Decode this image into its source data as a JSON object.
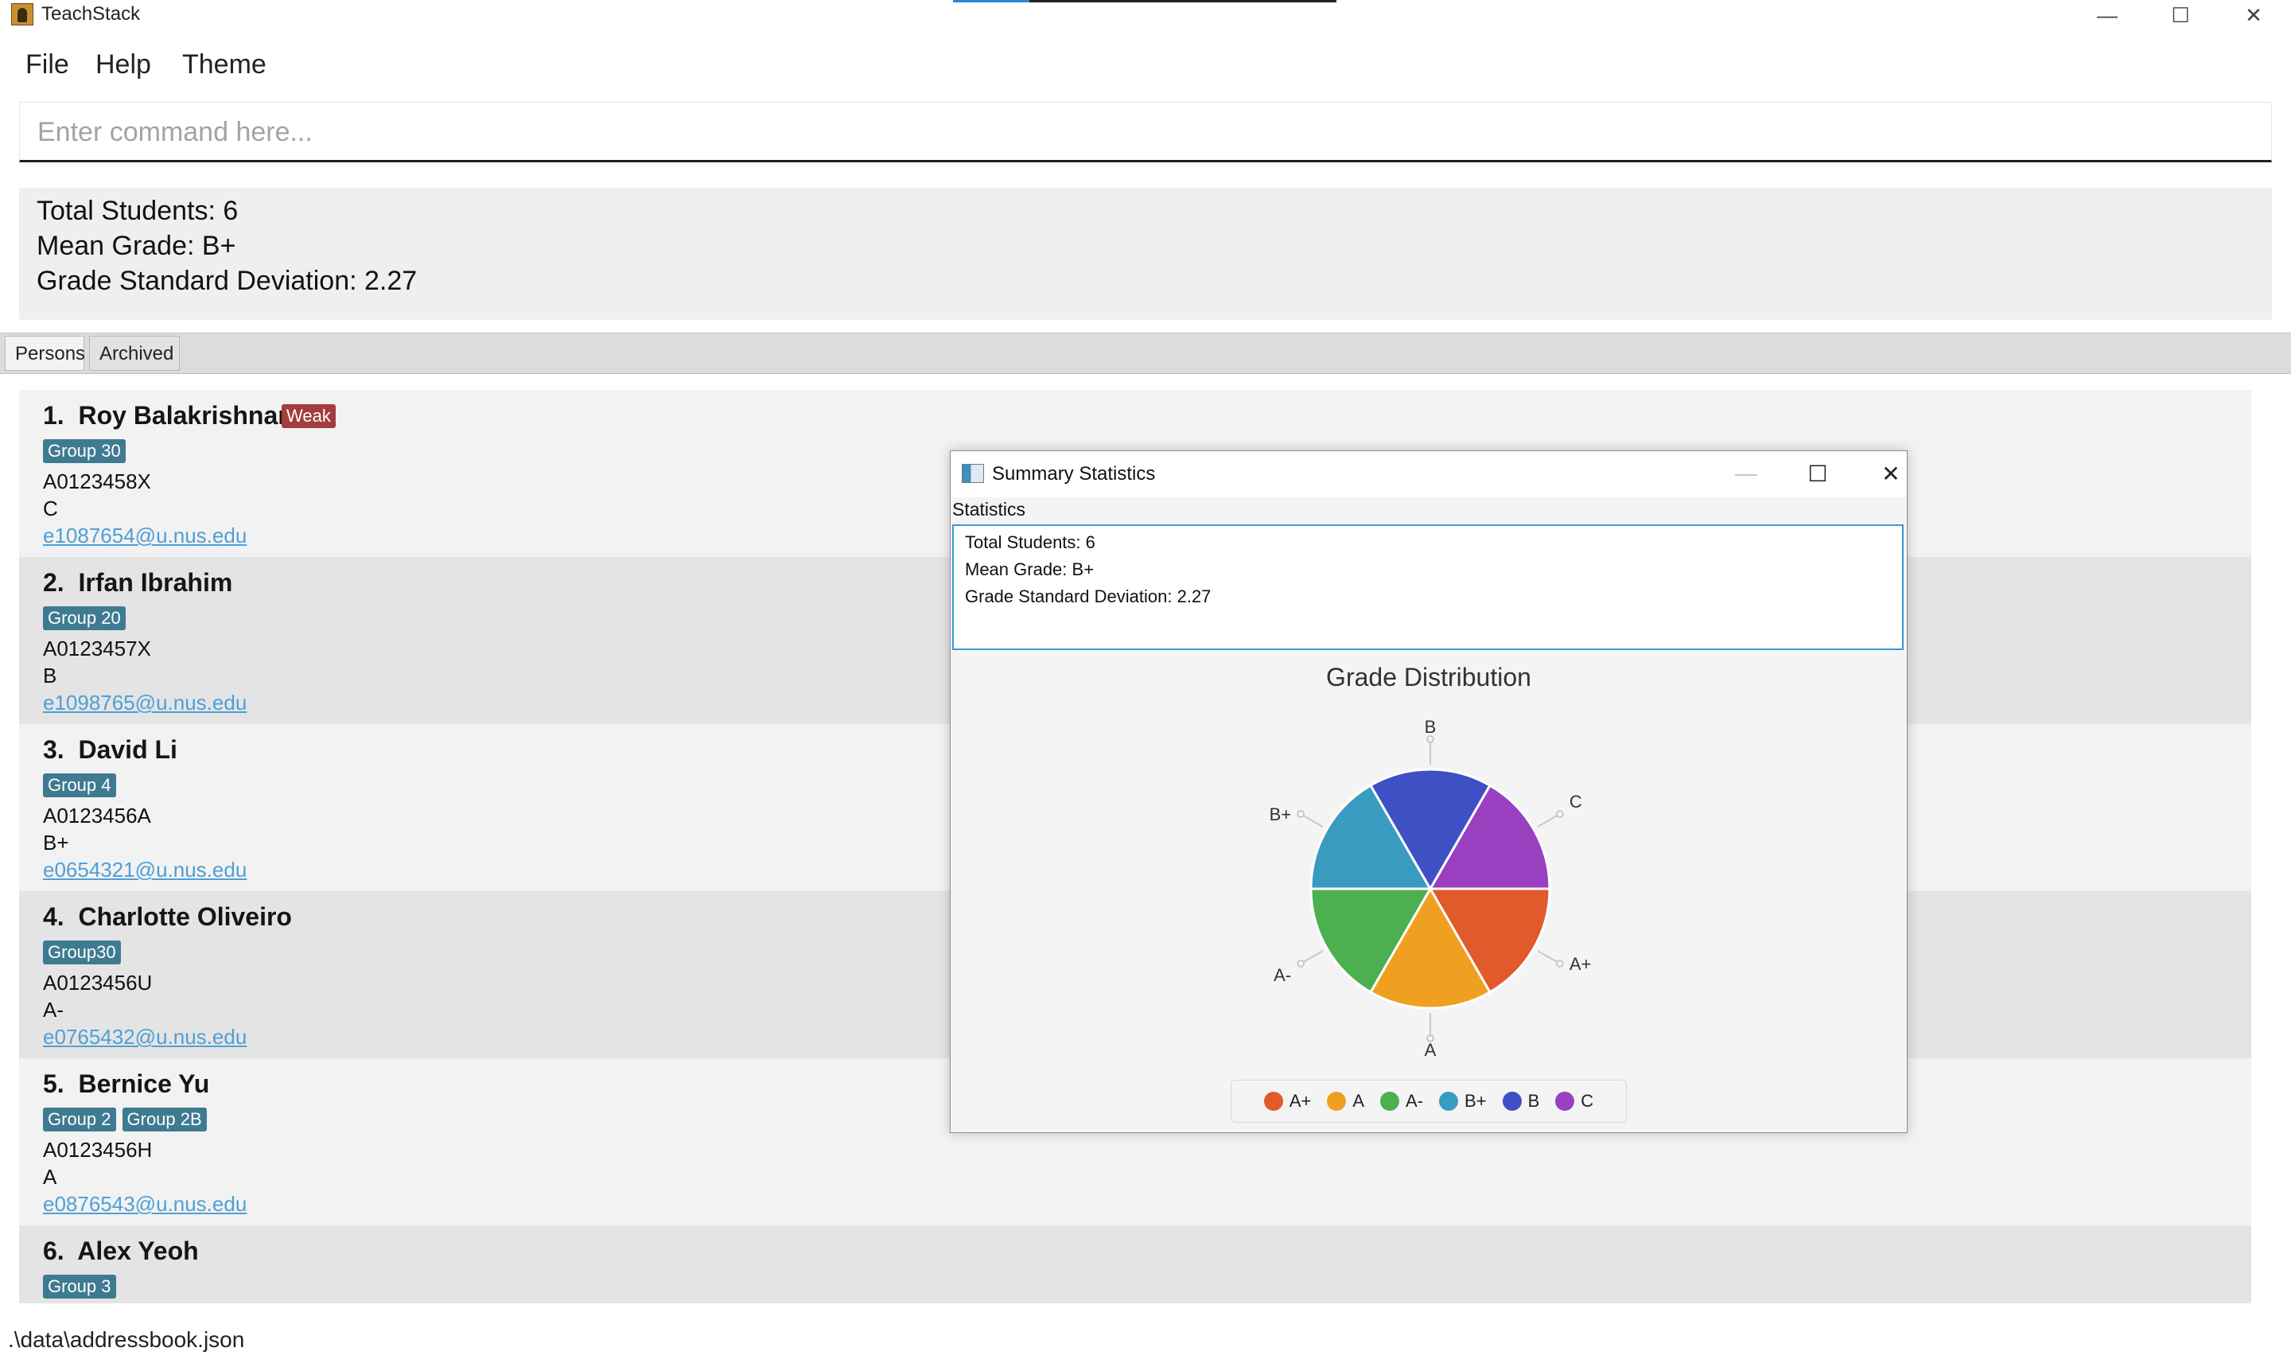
{
  "window": {
    "title": "TeachStack",
    "progress_fraction": 0.2,
    "controls": {
      "minimize": "—",
      "maximize": "☐",
      "close": "✕"
    }
  },
  "menu": [
    "File",
    "Help",
    "Theme"
  ],
  "command": {
    "placeholder": "Enter command here...",
    "value": ""
  },
  "result": {
    "lines": [
      "Total Students: 6",
      "Mean Grade: B+",
      "Grade Standard Deviation: 2.27"
    ]
  },
  "tabs": [
    {
      "label": "Persons",
      "selected": true
    },
    {
      "label": "Archived",
      "selected": false
    }
  ],
  "persons": [
    {
      "index": "1.",
      "name": "Roy Balakrishnan",
      "flag": "Weak",
      "groups": [
        "Group 30"
      ],
      "id": "A0123458X",
      "grade": "C",
      "email": "e1087654@u.nus.edu"
    },
    {
      "index": "2.",
      "name": "Irfan Ibrahim",
      "flag": "",
      "groups": [
        "Group 20"
      ],
      "id": "A0123457X",
      "grade": "B",
      "email": "e1098765@u.nus.edu"
    },
    {
      "index": "3.",
      "name": "David Li",
      "flag": "",
      "groups": [
        "Group 4"
      ],
      "id": "A0123456A",
      "grade": "B+",
      "email": "e0654321@u.nus.edu"
    },
    {
      "index": "4.",
      "name": "Charlotte Oliveiro",
      "flag": "",
      "groups": [
        "Group30"
      ],
      "id": "A0123456U",
      "grade": "A-",
      "email": "e0765432@u.nus.edu"
    },
    {
      "index": "5.",
      "name": "Bernice Yu",
      "flag": "",
      "groups": [
        "Group 2",
        "Group 2B"
      ],
      "id": "A0123456H",
      "grade": "A",
      "email": "e0876543@u.nus.edu"
    },
    {
      "index": "6.",
      "name": "Alex Yeoh",
      "flag": "",
      "groups": [
        "Group 3"
      ],
      "id": "",
      "grade": "",
      "email": ""
    }
  ],
  "status_bar": ".\\data\\addressbook.json",
  "popup": {
    "title": "Summary Statistics",
    "controls": {
      "minimize": "—",
      "maximize": "☐",
      "close": "✕"
    },
    "section_label": "Statistics",
    "text_lines": [
      "Total Students: 6",
      "Mean Grade: B+",
      "Grade Standard Deviation: 2.27"
    ]
  },
  "chart_data": {
    "type": "pie",
    "title": "Grade Distribution",
    "categories": [
      "A+",
      "A",
      "A-",
      "B+",
      "B",
      "C"
    ],
    "values": [
      1,
      1,
      1,
      1,
      1,
      1
    ],
    "colors": [
      "#e05a2b",
      "#f0a020",
      "#4caf50",
      "#3a9bc1",
      "#3f4fc4",
      "#9a3fbf"
    ],
    "legend_position": "bottom",
    "start_angle_deg": 0,
    "direction": "clockwise"
  }
}
